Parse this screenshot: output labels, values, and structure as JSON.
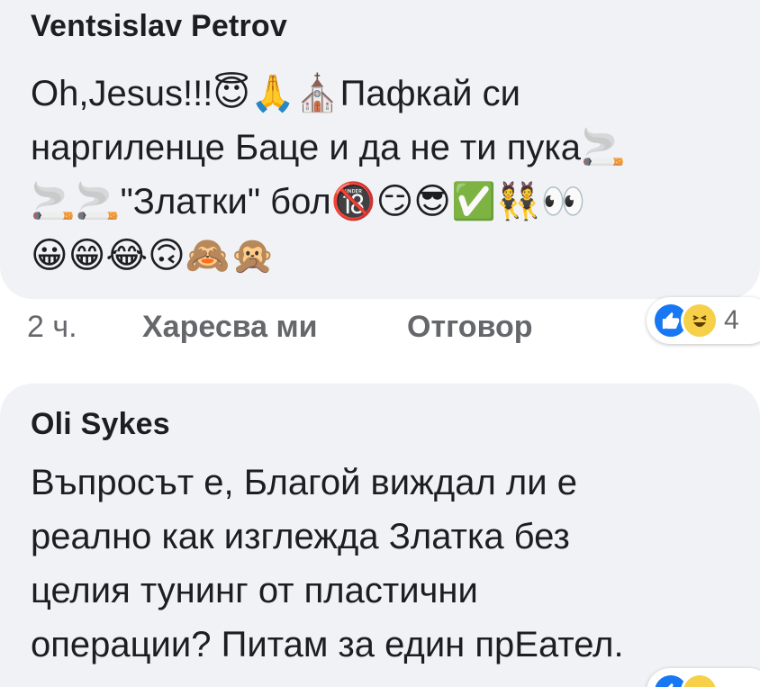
{
  "comments": [
    {
      "author": "Ventsislav Petrov",
      "lines": [
        "Oh,Jesus!!!😇🙏⛪Пафкай си",
        "наргиленце Баце и да не ти пука🚬",
        "🚬🚬\"Златки\" бол🔞😏😎✅👯👀",
        "😀😁😂🙃🙈🙊"
      ],
      "time": "2 ч.",
      "like_label": "Харесва ми",
      "reply_label": "Отговор",
      "reaction_count": "4"
    },
    {
      "author": "Oli Sykes",
      "lines": [
        "Въпросът е, Благой виждал ли е",
        "реално как изглежда Златка без",
        "целия тунинг от пластични",
        "операции? Питам за един прЕател."
      ]
    }
  ],
  "icons": {
    "like_reaction": "like-icon",
    "haha_reaction": "haha-icon"
  },
  "colors": {
    "bubble": "#f0f2f5",
    "meta": "#65676b",
    "like_blue": "#1877f2",
    "haha_yellow": "#f7d04a"
  }
}
